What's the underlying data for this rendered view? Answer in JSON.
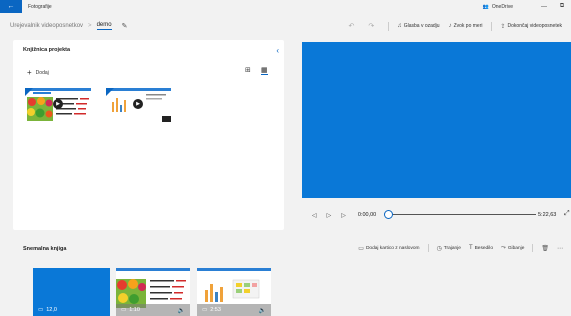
{
  "titlebar": {
    "back_icon": "back-arrow-icon",
    "app_title": "Fotografije",
    "onedrive_label": "OneDrive",
    "minimize": "—",
    "maximize": "⧉"
  },
  "toolbar": {
    "breadcrumb_root": "Urejevalnik videoposnetkov",
    "breadcrumb_separator": ">",
    "project_name": "demo",
    "undo_icon": "undo-icon",
    "redo_icon": "redo-icon",
    "background_music_label": "Glasba v ozadju",
    "custom_audio_label": "Zvok po meri",
    "finish_video_label": "Dokončaj videoposnetek"
  },
  "library": {
    "title": "Knjižnica projekta",
    "add_label": "Dodaj"
  },
  "playback": {
    "current_time": "0:00,00",
    "total_time": "5:22,63",
    "progress": 0.0
  },
  "storyboard": {
    "title": "Snemalna knjiga",
    "add_title_card_label": "Dodaj kartico z naslovom",
    "trim_label": "Trajanje",
    "text_label": "Besedilo",
    "motion_label": "Gibanje",
    "delete_icon": "trash-icon",
    "more_icon": "more-icon",
    "cards": [
      {
        "duration": "12,0",
        "type": "title-card"
      },
      {
        "duration": "1:10",
        "type": "video"
      },
      {
        "duration": "2:53",
        "type": "video"
      }
    ]
  },
  "colors": {
    "accent": "#0a66c2",
    "preview": "#0a78d7"
  }
}
